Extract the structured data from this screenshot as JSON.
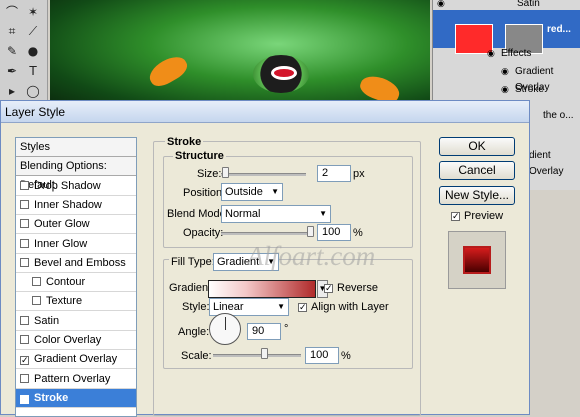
{
  "background": {
    "layers": {
      "rows": [
        "Satin",
        "red...",
        "Effects",
        "Gradient Overlay",
        "Stroke",
        "the o...",
        "dient Overlay"
      ],
      "selected_layer": "red..."
    }
  },
  "dialog": {
    "title": "Layer Style",
    "styles_list": {
      "items": [
        {
          "label": "Styles",
          "checked": null,
          "kind": "header"
        },
        {
          "label": "Blending Options: Default",
          "checked": null,
          "kind": "header"
        },
        {
          "label": "Drop Shadow",
          "checked": false
        },
        {
          "label": "Inner Shadow",
          "checked": false
        },
        {
          "label": "Outer Glow",
          "checked": false
        },
        {
          "label": "Inner Glow",
          "checked": false
        },
        {
          "label": "Bevel and Emboss",
          "checked": false
        },
        {
          "label": "Contour",
          "checked": false
        },
        {
          "label": "Texture",
          "checked": false
        },
        {
          "label": "Satin",
          "checked": false
        },
        {
          "label": "Color Overlay",
          "checked": false
        },
        {
          "label": "Gradient Overlay",
          "checked": true
        },
        {
          "label": "Pattern Overlay",
          "checked": false
        },
        {
          "label": "Stroke",
          "checked": true,
          "selected": true
        }
      ]
    },
    "stroke": {
      "group_title": "Stroke",
      "structure_title": "Structure",
      "size_label": "Size:",
      "size_value": "2",
      "size_unit": "px",
      "position_label": "Position:",
      "position_value": "Outside",
      "blend_mode_label": "Blend Mode:",
      "blend_mode_value": "Normal",
      "opacity_label": "Opacity:",
      "opacity_value": "100",
      "opacity_unit": "%",
      "fill_type_label": "Fill Type:",
      "fill_type_value": "Gradient",
      "gradient_label": "Gradient:",
      "reverse_label": "Reverse",
      "reverse_checked": true,
      "style_label": "Style:",
      "style_value": "Linear",
      "align_label": "Align with Layer",
      "align_checked": true,
      "angle_label": "Angle:",
      "angle_value": "90",
      "angle_unit": "°",
      "scale_label": "Scale:",
      "scale_value": "100",
      "scale_unit": "%"
    },
    "buttons": {
      "ok": "OK",
      "cancel": "Cancel",
      "new_style": "New Style..."
    },
    "preview": {
      "label": "Preview",
      "checked": true
    },
    "watermark": "Alfoart.com"
  }
}
